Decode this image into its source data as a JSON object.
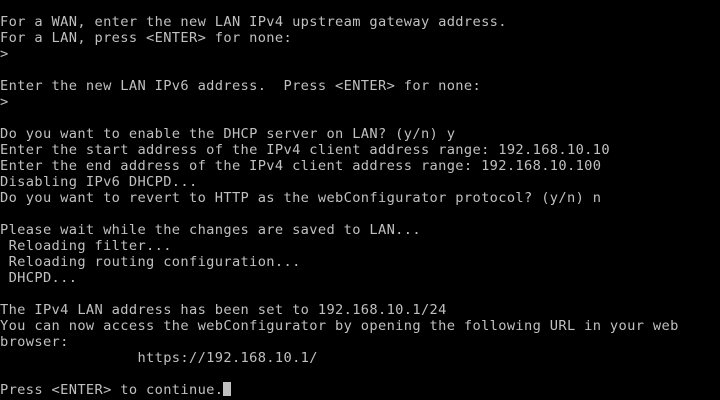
{
  "terminal": {
    "lines": [
      "For a WAN, enter the new LAN IPv4 upstream gateway address.",
      "For a LAN, press <ENTER> for none:",
      ">",
      "",
      "Enter the new LAN IPv6 address.  Press <ENTER> for none:",
      ">",
      "",
      "Do you want to enable the DHCP server on LAN? (y/n) y",
      "Enter the start address of the IPv4 client address range: 192.168.10.10",
      "Enter the end address of the IPv4 client address range: 192.168.10.100",
      "Disabling IPv6 DHCPD...",
      "Do you want to revert to HTTP as the webConfigurator protocol? (y/n) n",
      "",
      "Please wait while the changes are saved to LAN...",
      " Reloading filter...",
      " Reloading routing configuration...",
      " DHCPD...",
      "",
      "The IPv4 LAN address has been set to 192.168.10.1/24",
      "You can now access the webConfigurator by opening the following URL in your web",
      "browser:",
      "                https://192.168.10.1/",
      "",
      "Press <ENTER> to continue."
    ]
  }
}
